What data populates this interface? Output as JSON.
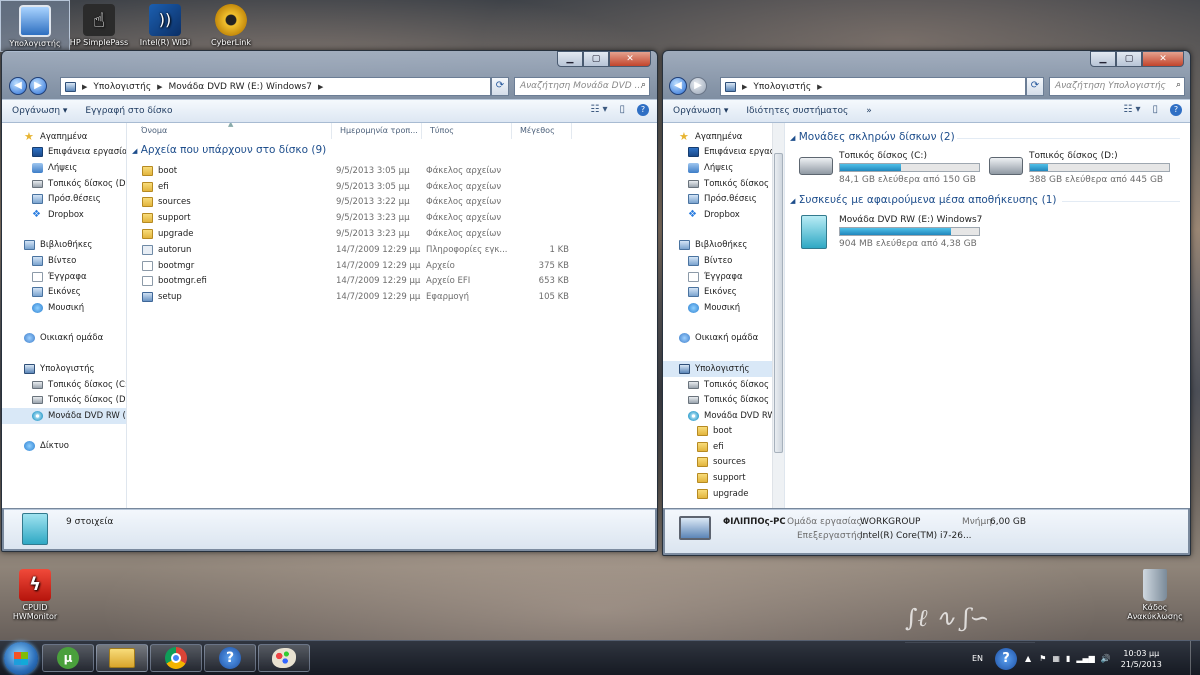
{
  "desktop": {
    "icons_top": [
      {
        "label": "Υπολογιστής"
      },
      {
        "label": "HP SimplePass"
      },
      {
        "label": "Intel(R) WiDi"
      },
      {
        "label": "CyberLink"
      }
    ],
    "icon_cpuid": {
      "line1": "CPUID",
      "line2": "HWMonitor"
    },
    "icon_recycle": {
      "line1": "Κάδος",
      "line2": "Ανακύκλωσης"
    }
  },
  "left_window": {
    "caption_buttons": {
      "minimize": "▁",
      "maximize": "▢",
      "close": "✕"
    },
    "address": {
      "parts": [
        "Υπολογιστής",
        "Μονάδα DVD RW (E:) Windows7"
      ]
    },
    "search_placeholder": "Αναζήτηση Μονάδα DVD ...",
    "toolbar": {
      "organize": "Οργάνωση ▾",
      "burn": "Εγγραφή στο δίσκο"
    },
    "nav": {
      "favorites_header": "Αγαπημένα",
      "favorites": [
        "Επιφάνεια εργασίας",
        "Λήψεις",
        "Τοπικός δίσκος (D)",
        "Πρόσ.θέσεις",
        "Dropbox"
      ],
      "libraries_header": "Βιβλιοθήκες",
      "libraries": [
        "Βίντεο",
        "Έγγραφα",
        "Εικόνες",
        "Μουσική"
      ],
      "homegroup": "Οικιακή ομάδα",
      "computer_header": "Υπολογιστής",
      "computer": [
        "Τοπικός δίσκος (C:)",
        "Τοπικός δίσκος (D:)",
        "Μονάδα DVD RW (E"
      ],
      "network": "Δίκτυο"
    },
    "columns": {
      "name": "Όνομα",
      "date": "Ημερομηνία τροπ...",
      "type": "Τύπος",
      "size": "Μέγεθος"
    },
    "group_title": "Αρχεία που υπάρχουν στο δίσκο (9)",
    "files": [
      {
        "name": "boot",
        "date": "9/5/2013 3:05 μμ",
        "type": "Φάκελος αρχείων",
        "size": ""
      },
      {
        "name": "efi",
        "date": "9/5/2013 3:05 μμ",
        "type": "Φάκελος αρχείων",
        "size": ""
      },
      {
        "name": "sources",
        "date": "9/5/2013 3:22 μμ",
        "type": "Φάκελος αρχείων",
        "size": ""
      },
      {
        "name": "support",
        "date": "9/5/2013 3:23 μμ",
        "type": "Φάκελος αρχείων",
        "size": ""
      },
      {
        "name": "upgrade",
        "date": "9/5/2013 3:23 μμ",
        "type": "Φάκελος αρχείων",
        "size": ""
      },
      {
        "name": "autorun",
        "date": "14/7/2009 12:29 μμ",
        "type": "Πληροφορίες εγκ...",
        "size": "1 KB"
      },
      {
        "name": "bootmgr",
        "date": "14/7/2009 12:29 μμ",
        "type": "Αρχείο",
        "size": "375 KB"
      },
      {
        "name": "bootmgr.efi",
        "date": "14/7/2009 12:29 μμ",
        "type": "Αρχείο EFI",
        "size": "653 KB"
      },
      {
        "name": "setup",
        "date": "14/7/2009 12:29 μμ",
        "type": "Εφαρμογή",
        "size": "105 KB"
      }
    ],
    "status": "9 στοιχεία"
  },
  "right_window": {
    "caption_buttons": {
      "minimize": "▁",
      "maximize": "▢",
      "close": "✕"
    },
    "address": {
      "parts": [
        "Υπολογιστής"
      ]
    },
    "search_placeholder": "Αναζήτηση Υπολογιστής",
    "toolbar": {
      "organize": "Οργάνωση ▾",
      "properties": "Ιδιότητες συστήματος",
      "more": "»"
    },
    "nav": {
      "favorites_header": "Αγαπημένα",
      "favorites": [
        "Επιφάνεια εργασ",
        "Λήψεις",
        "Τοπικός δίσκος (",
        "Πρόσ.θέσεις",
        "Dropbox"
      ],
      "libraries_header": "Βιβλιοθήκες",
      "libraries": [
        "Βίντεο",
        "Έγγραφα",
        "Εικόνες",
        "Μουσική"
      ],
      "homegroup": "Οικιακή ομάδα",
      "computer_header": "Υπολογιστής",
      "computer": [
        "Τοπικός δίσκος (",
        "Τοπικός δίσκος (",
        "Μονάδα DVD RW"
      ],
      "dvd_folders": [
        "boot",
        "efi",
        "sources",
        "support",
        "upgrade"
      ]
    },
    "hdd_group": "Μονάδες σκληρών δίσκων (2)",
    "drives": [
      {
        "name": "Τοπικός δίσκος (C:)",
        "free": "84,1 GB ελεύθερα από 150 GB",
        "used_fraction": 0.44
      },
      {
        "name": "Τοπικός δίσκος (D:)",
        "free": "388 GB ελεύθερα από 445 GB",
        "used_fraction": 0.13
      }
    ],
    "removable_group": "Συσκευές με αφαιρούμενα μέσα αποθήκευσης (1)",
    "dvd": {
      "name": "Μονάδα DVD RW (E:) Windows7",
      "free": "904 MB ελεύθερα από 4,38 GB",
      "used_fraction": 0.8
    },
    "details": {
      "pc_name": "ΦΙΛΙΠΠΟς-PC",
      "workgroup_label": "Ομάδα εργασίας:",
      "workgroup": "WORKGROUP",
      "memory_label": "Μνήμη:",
      "memory": "6,00 GB",
      "cpu_label": "Επεξεργαστής:",
      "cpu": "Intel(R) Core(TM) i7-26..."
    }
  },
  "taskbar": {
    "lang": "EN",
    "time": "10:03 μμ",
    "date": "21/5/2013"
  }
}
